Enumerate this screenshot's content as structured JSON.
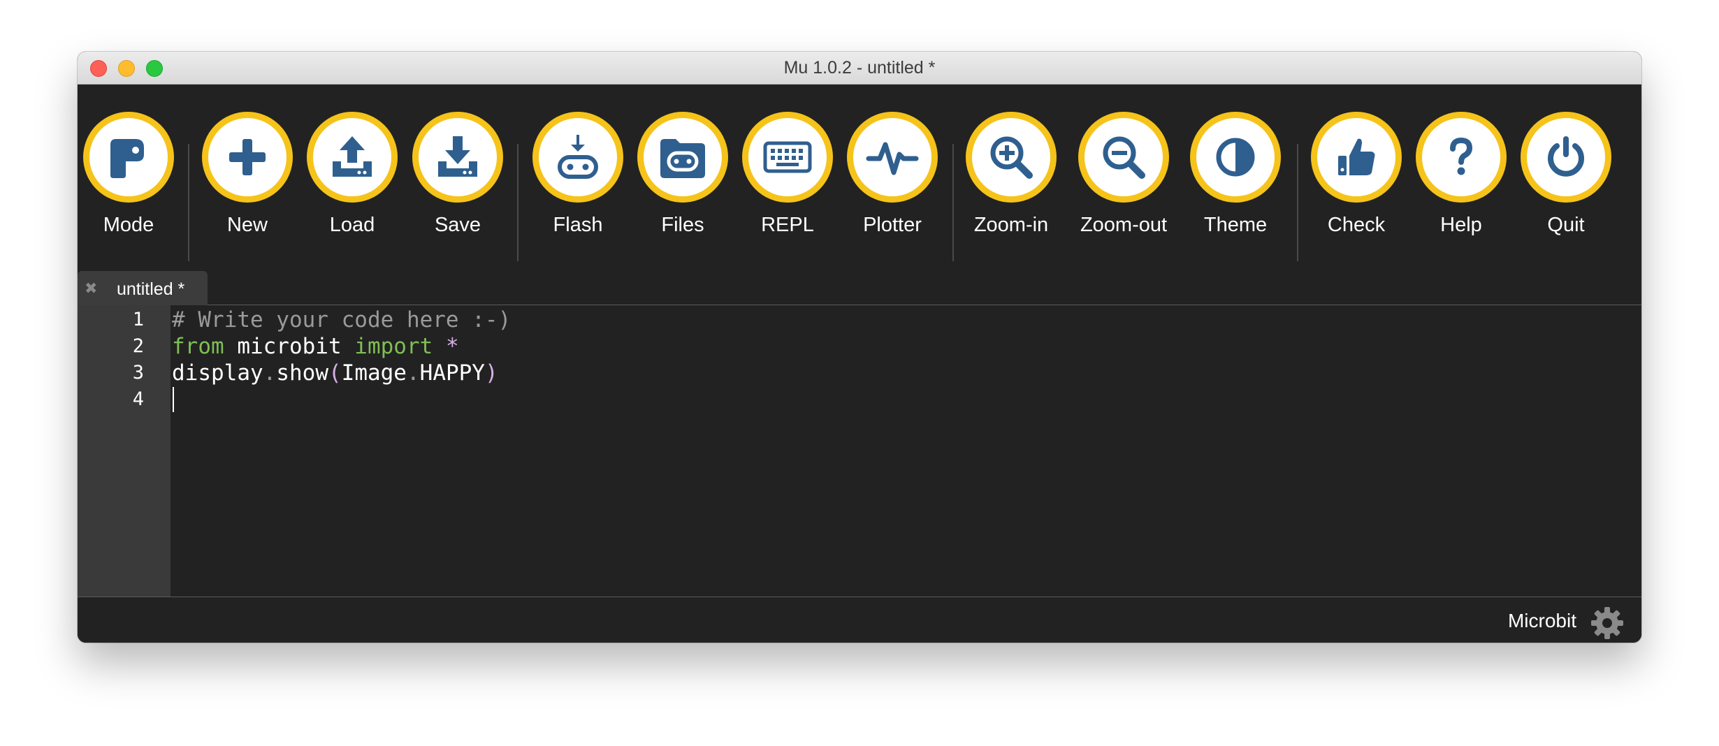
{
  "window": {
    "title": "Mu 1.0.2 - untitled *"
  },
  "theme": {
    "accent": "#f5c31a",
    "icon": "#2f5f8f",
    "background": "#222222"
  },
  "toolbar": {
    "buttons": [
      {
        "id": "mode",
        "label": "Mode",
        "icon": "python-logo-icon"
      },
      {
        "id": "new",
        "label": "New",
        "icon": "plus-icon"
      },
      {
        "id": "load",
        "label": "Load",
        "icon": "upload-icon"
      },
      {
        "id": "save",
        "label": "Save",
        "icon": "download-icon"
      },
      {
        "id": "flash",
        "label": "Flash",
        "icon": "flash-microbit-icon"
      },
      {
        "id": "files",
        "label": "Files",
        "icon": "folder-microbit-icon"
      },
      {
        "id": "repl",
        "label": "REPL",
        "icon": "keyboard-icon"
      },
      {
        "id": "plotter",
        "label": "Plotter",
        "icon": "pulse-icon"
      },
      {
        "id": "zoom-in",
        "label": "Zoom-in",
        "icon": "zoom-in-icon"
      },
      {
        "id": "zoom-out",
        "label": "Zoom-out",
        "icon": "zoom-out-icon"
      },
      {
        "id": "theme",
        "label": "Theme",
        "icon": "contrast-icon"
      },
      {
        "id": "check",
        "label": "Check",
        "icon": "thumbs-up-icon"
      },
      {
        "id": "help",
        "label": "Help",
        "icon": "question-icon"
      },
      {
        "id": "quit",
        "label": "Quit",
        "icon": "power-icon"
      }
    ]
  },
  "tabs": [
    {
      "label": "untitled *",
      "close_glyph": "✖",
      "active": true
    }
  ],
  "editor": {
    "line_numbers": [
      "1",
      "2",
      "3",
      "4"
    ],
    "lines": {
      "l1": {
        "comment": "# Write your code here :-)"
      },
      "l2": {
        "kw1": "from",
        "mod": " microbit ",
        "kw2": "import",
        "sp": " ",
        "star": "*"
      },
      "l3": {
        "obj": "display",
        "dot1": ".",
        "fn": "show",
        "lp": "(",
        "arg1": "Image",
        "dot2": ".",
        "arg2": "HAPPY",
        "rp": ")"
      },
      "l4": {}
    }
  },
  "status": {
    "mode": "Microbit",
    "settings_icon": "gear-icon"
  }
}
